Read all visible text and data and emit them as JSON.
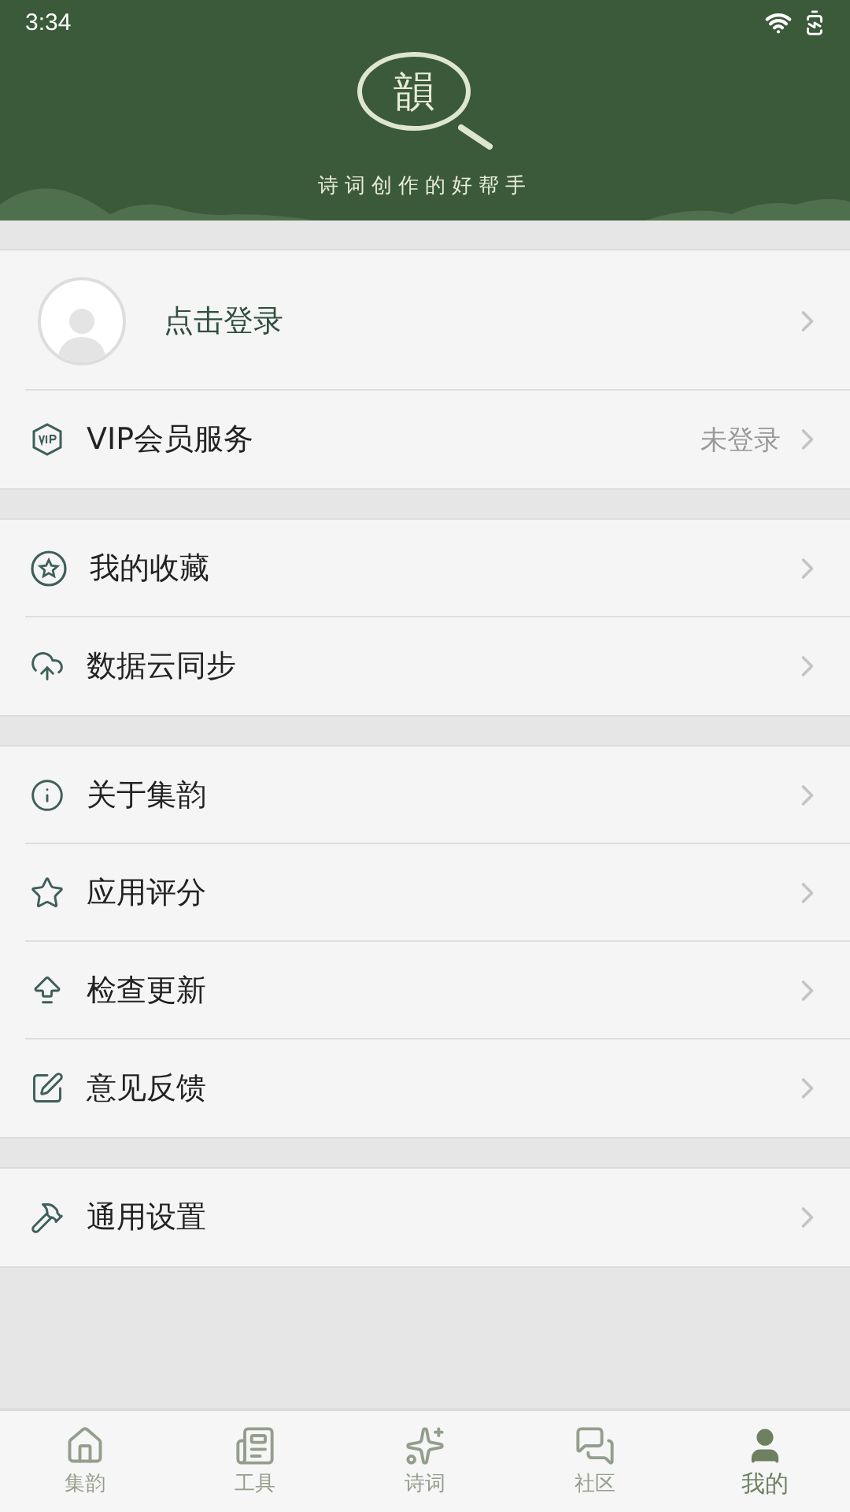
{
  "status_bar": {
    "time": "3:34"
  },
  "header": {
    "logo_char": "韻",
    "tagline": "诗词创作的好帮手"
  },
  "groups": [
    {
      "items": [
        {
          "kind": "profile",
          "label": "点击登录"
        },
        {
          "kind": "vip",
          "label": "VIP会员服务",
          "value": "未登录"
        }
      ]
    },
    {
      "items": [
        {
          "kind": "favorites",
          "label": "我的收藏"
        },
        {
          "kind": "cloud",
          "label": "数据云同步"
        }
      ]
    },
    {
      "items": [
        {
          "kind": "about",
          "label": "关于集韵"
        },
        {
          "kind": "rate",
          "label": "应用评分"
        },
        {
          "kind": "update",
          "label": "检查更新"
        },
        {
          "kind": "feedback",
          "label": "意见反馈"
        }
      ]
    },
    {
      "items": [
        {
          "kind": "settings",
          "label": "通用设置"
        }
      ]
    }
  ],
  "nav": [
    {
      "kind": "home",
      "label": "集韵",
      "selected": false
    },
    {
      "kind": "tools",
      "label": "工具",
      "selected": false
    },
    {
      "kind": "poems",
      "label": "诗词",
      "selected": false
    },
    {
      "kind": "community",
      "label": "社区",
      "selected": false
    },
    {
      "kind": "me",
      "label": "我的",
      "selected": true
    }
  ]
}
